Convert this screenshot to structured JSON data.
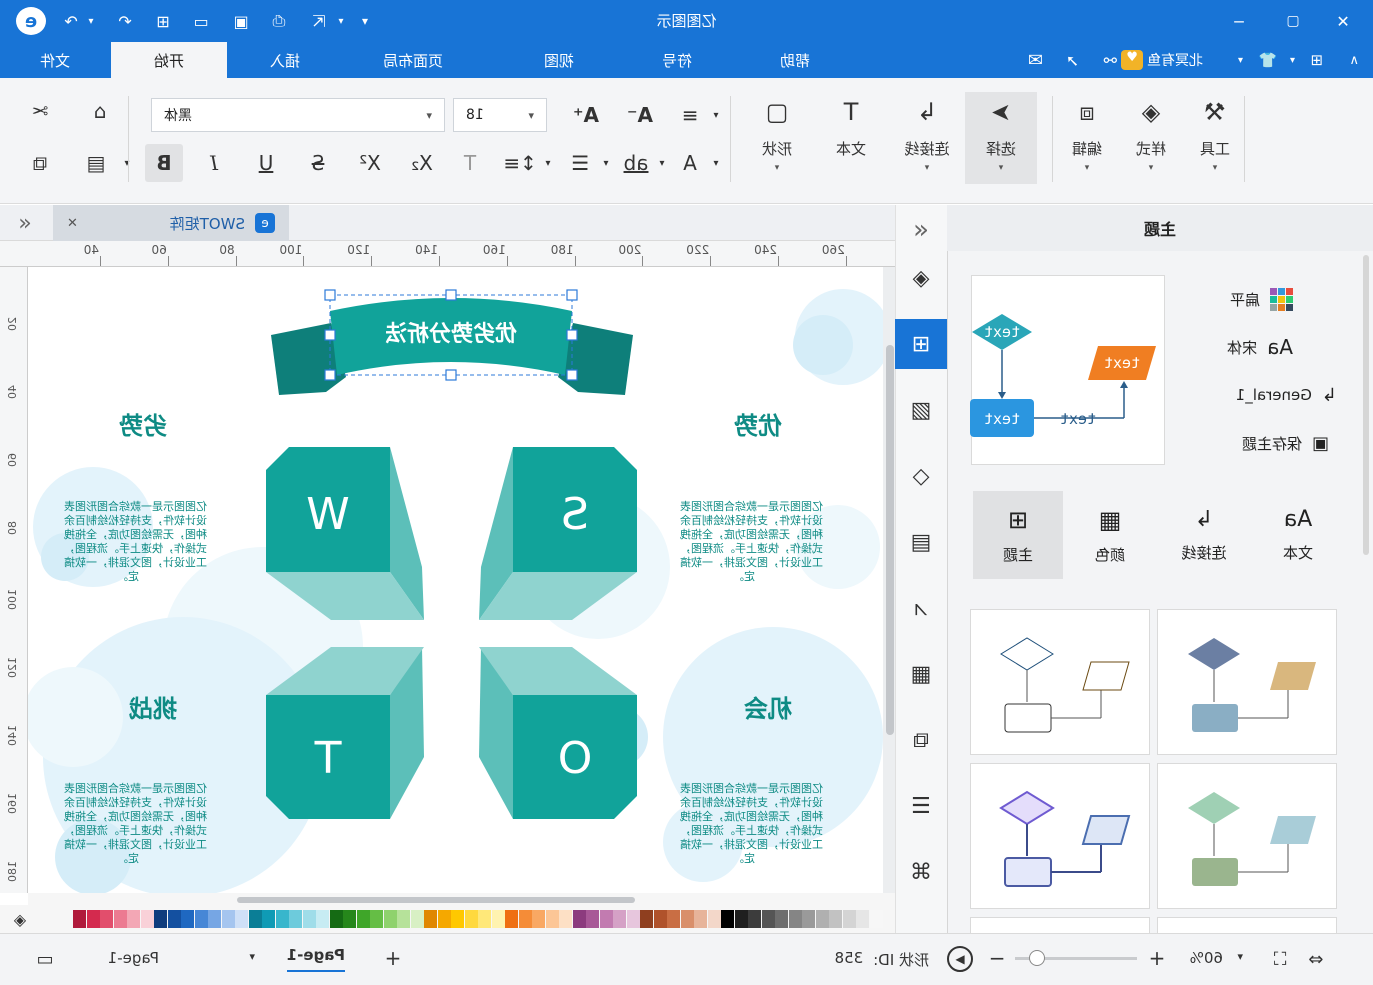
{
  "app": {
    "title": "亿图图示"
  },
  "tabs": [
    {
      "label": "文件",
      "active": false
    },
    {
      "label": "开始",
      "active": true
    },
    {
      "label": "插入",
      "active": false
    },
    {
      "label": "页面布局",
      "active": false
    },
    {
      "label": "视图",
      "active": false
    },
    {
      "label": "符号",
      "active": false
    },
    {
      "label": "帮助",
      "active": false
    }
  ],
  "account": {
    "name": "北冥有鱼"
  },
  "ribbon": {
    "font_name": "黑体",
    "font_size": "18",
    "shape_label": "形状",
    "text_label": "文本",
    "connector_label": "连接线",
    "select_label": "选择",
    "edit_label": "编辑",
    "style_label": "样式",
    "tools_label": "工具"
  },
  "left_panel": {
    "title": "主题",
    "options": [
      {
        "label": "扁平",
        "icon": "palette-grid-icon"
      },
      {
        "label": "宋体",
        "icon": "font-aa-icon"
      },
      {
        "label": "General_1",
        "icon": "connector-icon"
      },
      {
        "label": "保存主题",
        "icon": "save-icon"
      }
    ],
    "preview_text": "text",
    "categories": [
      {
        "label": "主题",
        "icon": "theme-grid-icon",
        "selected": true
      },
      {
        "label": "颜色",
        "icon": "color-grid-icon",
        "selected": false
      },
      {
        "label": "连接线",
        "icon": "connector-icon",
        "selected": false
      },
      {
        "label": "文本",
        "icon": "text-aa-icon",
        "selected": false
      }
    ]
  },
  "doc_tab": {
    "label": "SWOT矩阵"
  },
  "ruler_h": [
    "40",
    "60",
    "80",
    "100",
    "120",
    "140",
    "160",
    "180",
    "200",
    "220",
    "240",
    "260"
  ],
  "ruler_v": [
    "20",
    "40",
    "60",
    "80",
    "100",
    "120",
    "140",
    "160",
    "180"
  ],
  "diagram": {
    "title": "优劣势分析法",
    "quadrants": [
      {
        "heading": "优势",
        "letter": "S"
      },
      {
        "heading": "劣势",
        "letter": "W"
      },
      {
        "heading": "机会",
        "letter": "O"
      },
      {
        "heading": "挑战",
        "letter": "T"
      }
    ],
    "body_lines": [
      "亿图图示是一款综合图形图表",
      "设计软件，支持轻松绘制百余",
      "种图，无需绘图功底，全拖拽",
      "式操作，快速上手。流程图，",
      "工业设计，图文混排，一软搞",
      "定。"
    ],
    "colors": {
      "teal": "#11a39a",
      "teal_dark": "#0e8b84",
      "teal_light": "#8fd3cf",
      "teal_mid": "#5cbfb9",
      "heading": "#0e8b84",
      "bubble": "#e3f3fb"
    }
  },
  "status": {
    "page_label": "Page-1",
    "page_tab": "Page-1",
    "shape_id_label": "形状 ID:",
    "shape_id": "358",
    "zoom": "60%"
  }
}
